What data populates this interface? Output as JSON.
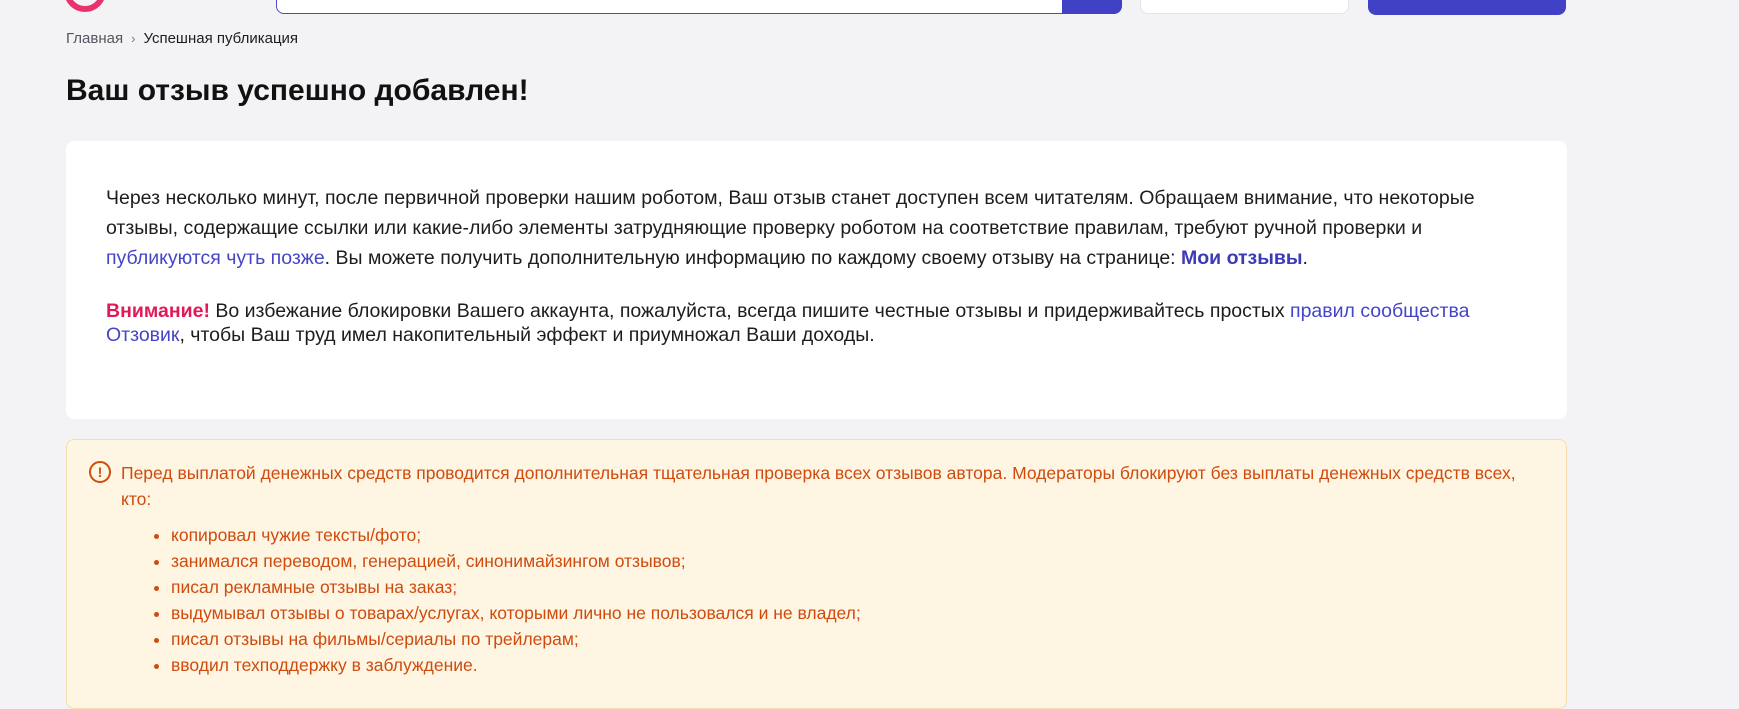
{
  "breadcrumb": {
    "home": "Главная",
    "separator": "›",
    "current": "Успешная публикация"
  },
  "page_title": "Ваш отзыв успешно добавлен!",
  "card": {
    "p1_text_a": "Через несколько минут, после первичной проверки нашим роботом, Ваш отзыв станет доступен всем читателям. Обращаем внимание, что некоторые отзывы, содержащие ссылки или какие-либо элементы затрудняющие проверку роботом на соответствие правилам, требуют ручной проверки и ",
    "p1_link": "публикуются чуть позже",
    "p1_text_b": ". Вы можете получить дополнительную информацию по каждому своему отзыву на странице: ",
    "p1_link_my_reviews": "Мои отзывы",
    "p1_text_c": ".",
    "warning_label": "Внимание!",
    "p2_text_a": " Во избежание блокировки Вашего аккаунта, пожалуйста, всегда пишите честные отзывы и придерживайтесь простых ",
    "p2_link": "правил сообщества Отзовик",
    "p2_text_b": ", чтобы Ваш труд имел накопительный эффект и приумножал Ваши доходы."
  },
  "notice": {
    "icon_glyph": "!",
    "intro": "Перед выплатой денежных средств проводится дополнительная тщательная проверка всех отзывов автора. Модераторы блокируют без выплаты денежных средств всех, кто:",
    "items": [
      "копировал чужие тексты/фото;",
      "занимался переводом, генерацией, синонимайзингом отзывов;",
      "писал рекламные отзывы на заказ;",
      "выдумывал отзывы о товарах/услугах, которыми лично не пользовался и не владел;",
      "писал отзывы на фильмы/сериалы по трейлерам;",
      "вводил техподдержку в заблуждение."
    ]
  },
  "colors": {
    "accent": "#4141c5",
    "warning": "#e01a59",
    "notice_text": "#cf4b0e",
    "notice_bg": "#fff5e3"
  }
}
